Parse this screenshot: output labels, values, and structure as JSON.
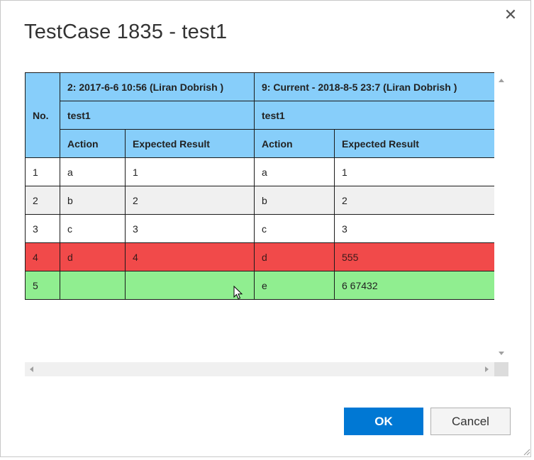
{
  "dialog": {
    "title": "TestCase 1835 - test1",
    "close_icon": "close-icon",
    "ok_label": "OK",
    "cancel_label": "Cancel"
  },
  "grid": {
    "no_header": "No.",
    "left": {
      "version": "2: 2017-6-6 10:56 (Liran Dobrish )",
      "name": "test1",
      "action_header": "Action",
      "expected_header": "Expected Result"
    },
    "right": {
      "version": "9: Current - 2018-8-5 23:7 (Liran Dobrish )",
      "name": "test1",
      "action_header": "Action",
      "expected_header": "Expected Result"
    },
    "rows": [
      {
        "no": "1",
        "l_action": "a",
        "l_expected": "1",
        "r_action": "a",
        "r_expected": "1",
        "state": "unchanged"
      },
      {
        "no": "2",
        "l_action": "b",
        "l_expected": "2",
        "r_action": "b",
        "r_expected": "2",
        "state": "unchanged"
      },
      {
        "no": "3",
        "l_action": "c",
        "l_expected": "3",
        "r_action": "c",
        "r_expected": "3",
        "state": "unchanged"
      },
      {
        "no": "4",
        "l_action": "d",
        "l_expected": "4",
        "r_action": "d",
        "r_expected": "555",
        "state": "changed"
      },
      {
        "no": "5",
        "l_action": "",
        "l_expected": "",
        "r_action": "e",
        "r_expected": "6 67432",
        "state": "added"
      }
    ]
  },
  "colors": {
    "header_bg": "#87cefa",
    "changed_row": "#f14a4a",
    "added_row": "#90ee90",
    "ok_button": "#0078d4"
  }
}
